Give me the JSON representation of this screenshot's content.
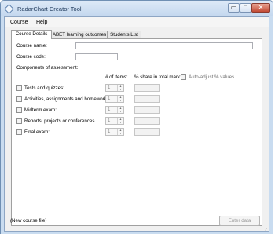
{
  "window": {
    "title": "RadarChart Creator Tool"
  },
  "controls": {
    "minimize": "▭",
    "maximize": "□",
    "close": "✕"
  },
  "menu": [
    "Course",
    "Help"
  ],
  "tabs": [
    "Course Details",
    "ABET learning outcomes",
    "Students List"
  ],
  "form": {
    "course_name_label": "Course name:",
    "course_name_value": "",
    "course_code_label": "Course code:",
    "course_code_value": "",
    "components_label": "Components of assessment:",
    "col_items": "# of items:",
    "col_share": "% share in total mark:",
    "auto_adjust_label": "Auto-adjust % values"
  },
  "components": [
    {
      "label": "Tests and quizzes:",
      "items": "1",
      "share": ""
    },
    {
      "label": "Activities, assignments and homeworks:",
      "items": "1",
      "share": ""
    },
    {
      "label": "Midterm exam:",
      "items": "1",
      "share": ""
    },
    {
      "label": "Reports, projects or conferences",
      "items": "1",
      "share": ""
    },
    {
      "label": "Final exam:",
      "items": "1",
      "share": ""
    }
  ],
  "status": "(New course file)",
  "enter_button": "Enter data"
}
